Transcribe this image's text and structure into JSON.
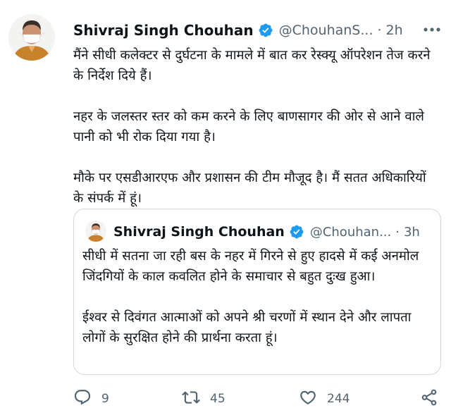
{
  "tweet": {
    "author_name": "Shivraj Singh Chouhan",
    "handle": "@ChouhanS...",
    "separator": "·",
    "time": "2h",
    "body_lines": [
      "मैंने सीधी कलेक्टर से दुर्घटना के मामले में बात कर रेस्क्यू ऑपरेशन तेज करने के निर्देश दिये हैं।",
      "नहर के जलस्तर स्तर को कम करने के लिए बाणसागर की ओर से आने वाले पानी को भी रोक दिया गया है।",
      "मौके पर एसडीआरएफ और प्रशासन की टीम मौजूद है। मैं सतत अधिकारियों के संपर्क में हूं।"
    ]
  },
  "quoted_tweet": {
    "author_name": "Shivraj Singh Chouhan",
    "handle": "@Chouhan...",
    "separator": "·",
    "time": "3h",
    "body_lines": [
      "सीधी में सतना जा रही बस के नहर में गिरने से हुए हादसे में कई अनमोल जिंदगियों के काल कवलित होने के समाचार से बहुत दुःख हुआ।",
      "ईश्वर से दिवंगत आत्माओं को अपने श्री चरणों में स्थान देने और लापता लोगों के सुरक्षित होने की प्रार्थना करता हूं।"
    ]
  },
  "actions": {
    "reply_count": "9",
    "retweet_count": "45",
    "like_count": "244"
  },
  "icons": {
    "verified": "verified-badge-icon",
    "more": "more-icon",
    "reply": "reply-icon",
    "retweet": "retweet-icon",
    "like": "like-icon",
    "share": "share-icon"
  },
  "colors": {
    "verified_blue": "#1d9bf0",
    "secondary_text": "#536471",
    "text": "#0f1419",
    "border": "#cfd9de"
  }
}
